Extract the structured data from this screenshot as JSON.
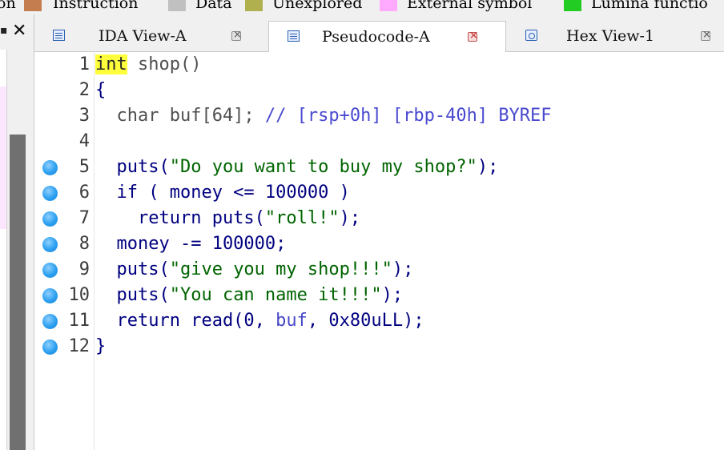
{
  "legend": {
    "items": [
      {
        "label": "on",
        "color": null
      },
      {
        "label": "Instruction",
        "color": "#c47d4f"
      },
      {
        "label": "Data",
        "color": "#c0c0c0"
      },
      {
        "label": "Unexplored",
        "color": "#b0b04e"
      },
      {
        "label": "External symbol",
        "color": "#ffaaff"
      },
      {
        "label": "Lumina functio",
        "color": "#22cc22"
      }
    ]
  },
  "tabs": [
    {
      "label": "IDA View-A",
      "icon": "ida-view-icon",
      "active": false
    },
    {
      "label": "Pseudocode-A",
      "icon": "pseudocode-icon",
      "active": true
    },
    {
      "label": "Hex View-1",
      "icon": "hex-view-icon",
      "active": false
    }
  ],
  "code": {
    "lines": [
      {
        "num": "1",
        "breakpoint": false,
        "tokens": [
          "int",
          " shop()"
        ]
      },
      {
        "num": "2",
        "breakpoint": false,
        "tokens": [
          "{"
        ]
      },
      {
        "num": "3",
        "breakpoint": false,
        "tokens": [
          "  char buf[64]; ",
          "// [rsp+0h] [rbp-40h] BYREF"
        ]
      },
      {
        "num": "4",
        "breakpoint": false,
        "tokens": [
          ""
        ]
      },
      {
        "num": "5",
        "breakpoint": true,
        "tokens": [
          "  puts(",
          "\"Do you want to buy my shop?\"",
          ");"
        ]
      },
      {
        "num": "6",
        "breakpoint": true,
        "tokens": [
          "  if ( money <= 100000 )"
        ]
      },
      {
        "num": "7",
        "breakpoint": true,
        "tokens": [
          "    return puts(",
          "\"roll!\"",
          ");"
        ]
      },
      {
        "num": "8",
        "breakpoint": true,
        "tokens": [
          "  money -= 100000;"
        ]
      },
      {
        "num": "9",
        "breakpoint": true,
        "tokens": [
          "  puts(",
          "\"give you my shop!!!\"",
          ");"
        ]
      },
      {
        "num": "10",
        "breakpoint": true,
        "tokens": [
          "  puts(",
          "\"You can name it!!!\"",
          ");"
        ]
      },
      {
        "num": "11",
        "breakpoint": true,
        "tokens": [
          "  return read(0, ",
          "buf",
          ", 0x80uLL);"
        ]
      },
      {
        "num": "12",
        "breakpoint": true,
        "tokens": [
          "}"
        ]
      }
    ]
  }
}
